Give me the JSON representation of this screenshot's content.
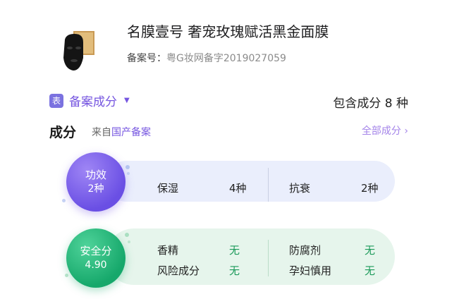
{
  "product": {
    "name": "名膜壹号 奢宠玫瑰赋活黑金面膜",
    "reg_label": "备案号：",
    "reg_number": "粤G妆网备字2019027059"
  },
  "filing": {
    "tag": "表",
    "label": "备案成分",
    "caret": "▼",
    "total": "包含成分 8 种"
  },
  "ingredients": {
    "title": "成分",
    "source_prefix": "来自",
    "source": "国产备案",
    "all_link": "全部成分 ›"
  },
  "efficacy": {
    "title": "功效",
    "count": "2种",
    "items": [
      {
        "name": "保湿",
        "value": "4种"
      },
      {
        "name": "抗衰",
        "value": "2种"
      }
    ]
  },
  "safety": {
    "title": "安全分",
    "score": "4.90",
    "items": [
      {
        "name": "香精",
        "value": "无"
      },
      {
        "name": "风险成分",
        "value": "无"
      },
      {
        "name": "防腐剂",
        "value": "无"
      },
      {
        "name": "孕妇慎用",
        "value": "无"
      }
    ]
  },
  "colors": {
    "accent": "#7656e0",
    "safety_green": "#1c9a5a",
    "efficacy_card": "#eaeefc",
    "safety_card": "#e6f5ec"
  }
}
